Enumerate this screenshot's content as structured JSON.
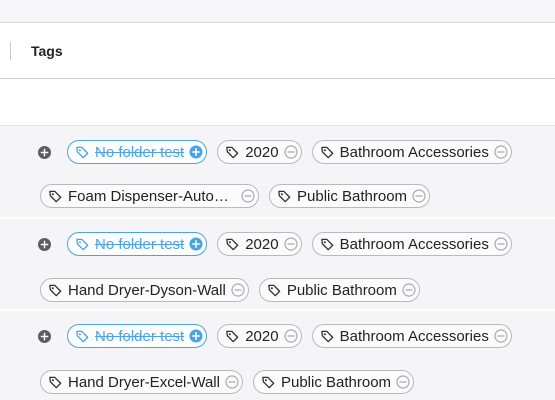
{
  "column": {
    "title": "Tags"
  },
  "rows": [
    {
      "tags_line1": [
        {
          "label": "No folder test",
          "primary": true
        },
        {
          "label": "2020"
        },
        {
          "label": "Bathroom Accessories"
        }
      ],
      "tags_line2": [
        {
          "label": "Foam Dispenser-Automatic"
        },
        {
          "label": "Public Bathroom"
        }
      ]
    },
    {
      "tags_line1": [
        {
          "label": "No folder test",
          "primary": true
        },
        {
          "label": "2020"
        },
        {
          "label": "Bathroom Accessories"
        }
      ],
      "tags_line2": [
        {
          "label": "Hand Dryer-Dyson-Wall"
        },
        {
          "label": "Public Bathroom"
        }
      ]
    },
    {
      "tags_line1": [
        {
          "label": "No folder test",
          "primary": true
        },
        {
          "label": "2020"
        },
        {
          "label": "Bathroom Accessories"
        }
      ],
      "tags_line2": [
        {
          "label": "Hand Dryer-Excel-Wall"
        },
        {
          "label": "Public Bathroom"
        }
      ]
    }
  ],
  "colors": {
    "accent": "#4aa3e8",
    "chip_border": "#b8b8bf",
    "icon_dark": "#5c5c62"
  },
  "icons": {
    "tag": "tag-icon",
    "add": "add-circle-icon",
    "remove": "minus-circle-icon"
  }
}
